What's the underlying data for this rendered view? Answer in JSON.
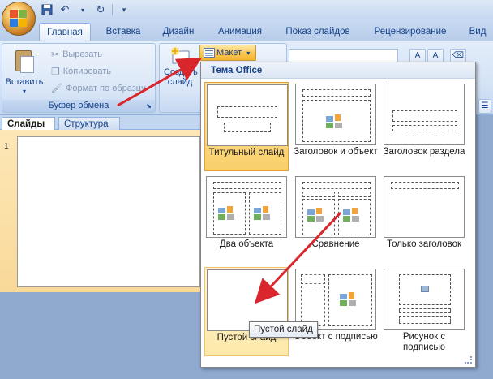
{
  "tabs": [
    "Главная",
    "Вставка",
    "Дизайн",
    "Анимация",
    "Показ слайдов",
    "Рецензирование",
    "Вид"
  ],
  "clipboard": {
    "paste_label": "Вставить",
    "cut_label": "Вырезать",
    "copy_label": "Копировать",
    "format_label": "Формат по образцу",
    "group_label": "Буфер обмена"
  },
  "slides": {
    "new_slide_label": "Создать слайд",
    "layout_button_label": "Макет"
  },
  "pane": {
    "tab_slides": "Слайды",
    "tab_outline": "Структура",
    "slide_number": "1"
  },
  "gallery": {
    "header": "Тема Office",
    "layouts": [
      {
        "label": "Титульный слайд"
      },
      {
        "label": "Заголовок и объект"
      },
      {
        "label": "Заголовок раздела"
      },
      {
        "label": "Два объекта"
      },
      {
        "label": "Сравнение"
      },
      {
        "label": "Только заголовок"
      },
      {
        "label": "Пустой слайд"
      },
      {
        "label": "Объект с подписью"
      },
      {
        "label": "Рисунок с подписью"
      }
    ]
  },
  "tooltip": "Пустой слайд",
  "colors": {
    "selected": "#f9cf6a",
    "arrow": "#d9262c",
    "ribbon": "#d4e3f6"
  }
}
